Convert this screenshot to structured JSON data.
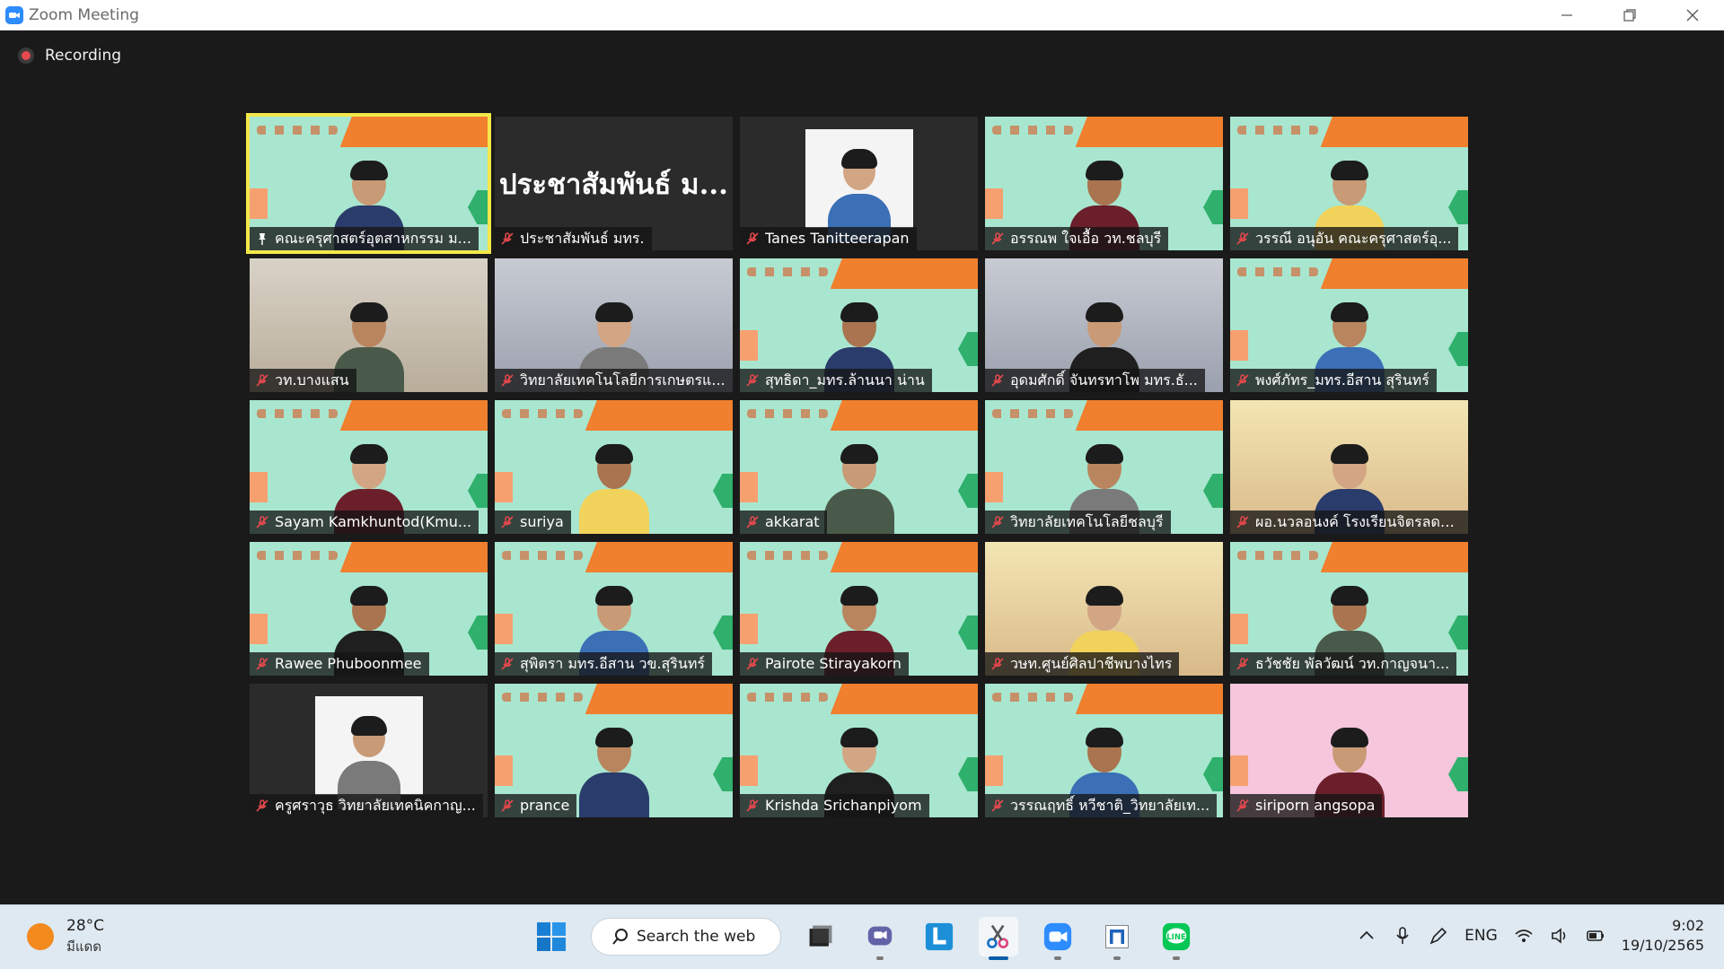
{
  "window": {
    "title": "Zoom Meeting"
  },
  "recording": {
    "label": "Recording"
  },
  "participants": [
    {
      "name": "คณะครุศาสตร์อุตสาหกรรม ม...",
      "bg": "banner",
      "active": true,
      "mic": "pin"
    },
    {
      "name": "ประชาสัมพันธ์ มทร.",
      "bg": "dark",
      "big_text": "ประชาสัมพันธ์ ม...",
      "mic": "muted"
    },
    {
      "name": "Tanes Tanitteerapan",
      "bg": "dark-photo",
      "mic": "muted"
    },
    {
      "name": "อรรณพ  ใจเอื้อ วท.ชลบุรี",
      "bg": "banner",
      "mic": "muted"
    },
    {
      "name": "วรรณี  อนุอัน คณะครุศาสตร์อุ...",
      "bg": "banner",
      "mic": "muted"
    },
    {
      "name": "วท.บางแสน",
      "bg": "room",
      "mic": "muted"
    },
    {
      "name": "วิทยาลัยเทคโนโลยีการเกษตรแ...",
      "bg": "room2",
      "mic": "muted"
    },
    {
      "name": "สุทธิดา_มทร.ล้านนา น่าน",
      "bg": "banner",
      "mic": "muted"
    },
    {
      "name": "อุดมศักดิ์ จันทรทาโพ มทร.ธั...",
      "bg": "room2",
      "mic": "muted"
    },
    {
      "name": "พงศ์ภัทร_มทร.อีสาน สุรินทร์",
      "bg": "banner",
      "mic": "muted"
    },
    {
      "name": "Sayam Kamkhuntod(Kmu...",
      "bg": "banner",
      "mic": "muted"
    },
    {
      "name": "suriya",
      "bg": "banner",
      "mic": "muted"
    },
    {
      "name": "akkarat",
      "bg": "banner",
      "mic": "muted"
    },
    {
      "name": "วิทยาลัยเทคโนโลยีชลบุรี",
      "bg": "banner",
      "mic": "muted"
    },
    {
      "name": "ผอ.นวลอนงค์ โรงเรียนจิตรลดา...",
      "bg": "room3",
      "mic": "muted"
    },
    {
      "name": "Rawee Phuboonmee",
      "bg": "banner",
      "mic": "muted"
    },
    {
      "name": "สุพิตรา มทร.อีสาน วข.สุรินทร์",
      "bg": "banner",
      "mic": "muted"
    },
    {
      "name": "Pairote Stirayakorn",
      "bg": "banner",
      "mic": "muted"
    },
    {
      "name": "วษท.ศูนย์ศิลปาชีพบางไทร",
      "bg": "room3",
      "mic": "muted"
    },
    {
      "name": "ธวัชชัย  พัลวัฒน์ วท.กาญจนา...",
      "bg": "banner",
      "mic": "muted"
    },
    {
      "name": "ครูศราวุธ วิทยาลัยเทคนิคกาญ...",
      "bg": "dark-photo",
      "mic": "muted"
    },
    {
      "name": "prance",
      "bg": "banner",
      "mic": "muted"
    },
    {
      "name": "Krishda Srichanpiyom",
      "bg": "banner",
      "mic": "muted"
    },
    {
      "name": "วรรณฤทธิ์ หวีชาติ_วิทยาลัยเท...",
      "bg": "banner",
      "mic": "muted"
    },
    {
      "name": "siriporn angsopa",
      "bg": "pink",
      "mic": "muted"
    }
  ],
  "taskbar": {
    "weather_temp": "28°C",
    "weather_desc": "มีแดด",
    "search_label": "Search the web",
    "apps": [
      "start-icon",
      "file-explorer-icon",
      "teams-icon",
      "l-app-icon",
      "snipping-tool-icon",
      "zoom-icon",
      "news-icon",
      "line-icon"
    ],
    "language": "ENG",
    "time": "9:02",
    "date": "19/10/2565"
  },
  "colors": {
    "accent_active_tile": "#f3e84a",
    "muted_mic": "#e5484d",
    "zoom_blue": "#2d8cff"
  }
}
